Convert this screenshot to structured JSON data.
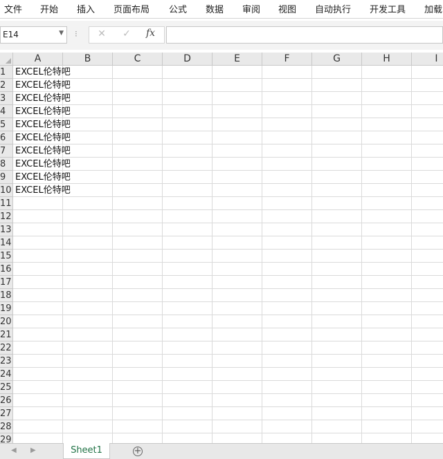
{
  "ribbon": {
    "tabs": [
      "文件",
      "开始",
      "插入",
      "页面布局",
      "公式",
      "数据",
      "审阅",
      "视图",
      "自动执行",
      "开发工具",
      "加载"
    ]
  },
  "formula_bar": {
    "name_box": "E14",
    "formula": "",
    "fx_label": "fx",
    "cancel_glyph": "✕",
    "enter_glyph": "✓"
  },
  "grid": {
    "columns": [
      "A",
      "B",
      "C",
      "D",
      "E",
      "F",
      "G",
      "H",
      "I"
    ],
    "rows": [
      "1",
      "2",
      "3",
      "4",
      "5",
      "6",
      "7",
      "8",
      "9",
      "10",
      "11",
      "12",
      "13",
      "14",
      "15",
      "16",
      "17",
      "18",
      "19",
      "20",
      "21",
      "22",
      "23",
      "24",
      "25",
      "26",
      "27",
      "28",
      "29"
    ],
    "column_a_values": [
      "EXCEL伦特吧",
      "EXCEL伦特吧",
      "EXCEL伦特吧",
      "EXCEL伦特吧",
      "EXCEL伦特吧",
      "EXCEL伦特吧",
      "EXCEL伦特吧",
      "EXCEL伦特吧",
      "EXCEL伦特吧",
      "EXCEL伦特吧"
    ]
  },
  "sheets": {
    "tabs": [
      "Sheet1"
    ],
    "add_glyph": "+"
  },
  "colors": {
    "active_sheet_text": "#217346",
    "header_bg": "#e9e9e9",
    "gridline": "#dadada"
  }
}
